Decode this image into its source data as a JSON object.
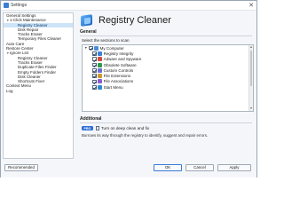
{
  "window": {
    "title": "Settings",
    "close": "✕"
  },
  "nav": [
    {
      "label": "General Settings",
      "level": 0
    },
    {
      "label": "1-Click Maintenance",
      "level": 0,
      "expanded": true
    },
    {
      "label": "Registry Cleaner",
      "level": 1,
      "selected": true
    },
    {
      "label": "Disk Repair",
      "level": 1
    },
    {
      "label": "Tracks Eraser",
      "level": 1
    },
    {
      "label": "Temporary Files Cleaner",
      "level": 1
    },
    {
      "label": "Auto Care",
      "level": 0
    },
    {
      "label": "Restore Center",
      "level": 0
    },
    {
      "label": "Ignore List",
      "level": 0,
      "expanded": true
    },
    {
      "label": "Registry Cleaner",
      "level": 1
    },
    {
      "label": "Tracks Eraser",
      "level": 1
    },
    {
      "label": "Duplicate Files Finder",
      "level": 1
    },
    {
      "label": "Empty Folders Finder",
      "level": 1
    },
    {
      "label": "Disk Cleaner",
      "level": 1
    },
    {
      "label": "Shortcuts Fixer",
      "level": 1
    },
    {
      "label": "Context Menu",
      "level": 0
    },
    {
      "label": "Log",
      "level": 0
    }
  ],
  "page": {
    "title": "Registry Cleaner"
  },
  "general": {
    "heading": "General",
    "prompt": "Select the sections to scan",
    "root": {
      "label": "My Computer",
      "icon": "computer-icon"
    },
    "items": [
      {
        "label": "Registry Integrity",
        "icon": "registry-icon",
        "color": "#3b82d6"
      },
      {
        "label": "Adware and Spyware",
        "icon": "shield-icon",
        "color": "#d44a3a"
      },
      {
        "label": "Obsolete Software",
        "icon": "package-icon",
        "color": "#2e9a4a"
      },
      {
        "label": "Custom Controls",
        "icon": "controls-icon",
        "color": "#6b6fd6"
      },
      {
        "label": "File Extensions",
        "icon": "file-icon",
        "color": "#c99a2e"
      },
      {
        "label": "File Associations",
        "icon": "link-icon",
        "color": "#8a5bd0"
      },
      {
        "label": "Start Menu",
        "icon": "start-menu-icon",
        "color": "#2f89c9"
      }
    ]
  },
  "additional": {
    "heading": "Additional",
    "pro_badge": "PRO",
    "deep_clean_label": "Turn on deep clean and fix",
    "description": "Burrows its way through the registry to identify, suggest and repair errors."
  },
  "footer": {
    "recommended_label": "Recommended",
    "ok_label": "OK",
    "cancel_label": "Cancel",
    "apply_label": "Apply"
  },
  "colors": {
    "accent": "#2e6fd8",
    "selection": "#cde3f8"
  }
}
